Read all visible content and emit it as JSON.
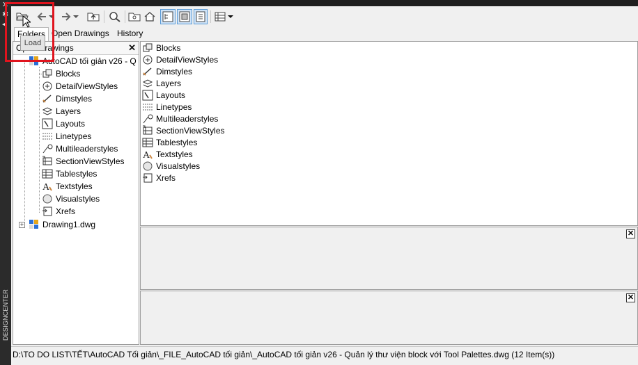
{
  "side_panel": {
    "vertical_title": "DESIGNCENTER",
    "icons": [
      "close-icon",
      "properties-icon",
      "autohide-icon"
    ]
  },
  "toolbar": {
    "buttons": [
      {
        "name": "load-button",
        "icon": "open-folder-icon"
      },
      {
        "name": "back-button",
        "icon": "arrow-left-icon"
      },
      {
        "name": "forward-button",
        "icon": "arrow-right-icon"
      },
      {
        "name": "up-button",
        "icon": "folder-up-icon"
      },
      {
        "name": "search-button",
        "icon": "search-icon"
      },
      {
        "name": "favorites-button",
        "icon": "favorites-folder-icon"
      },
      {
        "name": "home-button",
        "icon": "home-icon"
      },
      {
        "name": "tree-view-toggle",
        "icon": "tree-view-icon",
        "pressed": true
      },
      {
        "name": "preview-toggle",
        "icon": "preview-icon",
        "pressed": true
      },
      {
        "name": "description-toggle",
        "icon": "description-icon",
        "pressed": true
      },
      {
        "name": "views-button",
        "icon": "views-icon"
      }
    ]
  },
  "tooltip": {
    "text": "Load"
  },
  "tabs": [
    {
      "label": "Folders",
      "active": true
    },
    {
      "label": "Open Drawings",
      "active": false
    },
    {
      "label": "History",
      "active": false
    }
  ],
  "tree": {
    "header_label": "Open Drawings",
    "root": {
      "label": "AutoCAD tối giản v26 - Q",
      "expanded": true
    },
    "children": [
      {
        "label": "Blocks",
        "icon": "blocks-icon"
      },
      {
        "label": "DetailViewStyles",
        "icon": "detailviewstyles-icon"
      },
      {
        "label": "Dimstyles",
        "icon": "dimstyles-icon"
      },
      {
        "label": "Layers",
        "icon": "layers-icon"
      },
      {
        "label": "Layouts",
        "icon": "layouts-icon"
      },
      {
        "label": "Linetypes",
        "icon": "linetypes-icon"
      },
      {
        "label": "Multileaderstyles",
        "icon": "multileaderstyles-icon"
      },
      {
        "label": "SectionViewStyles",
        "icon": "sectionviewstyles-icon"
      },
      {
        "label": "Tablestyles",
        "icon": "tablestyles-icon"
      },
      {
        "label": "Textstyles",
        "icon": "textstyles-icon"
      },
      {
        "label": "Visualstyles",
        "icon": "visualstyles-icon"
      },
      {
        "label": "Xrefs",
        "icon": "xrefs-icon"
      }
    ],
    "second": {
      "label": "Drawing1.dwg",
      "expanded": false
    }
  },
  "content_list": [
    "Blocks",
    "DetailViewStyles",
    "Dimstyles",
    "Layers",
    "Layouts",
    "Linetypes",
    "Multileaderstyles",
    "SectionViewStyles",
    "Tablestyles",
    "Textstyles",
    "Visualstyles",
    "Xrefs"
  ],
  "status": {
    "path": "D:\\TO DO LIST\\TẾT\\AutoCAD Tối giản\\_FILE_AutoCAD tối giản\\_AutoCAD tối giản v26 - Quản lý thư viện block với Tool Palettes.dwg (12 Item(s))"
  },
  "colors": {
    "highlight": "#e0141e",
    "pressed_bg": "#cfe3f7",
    "pressed_border": "#5b9bd5",
    "side_strip": "#2b2b2b"
  }
}
